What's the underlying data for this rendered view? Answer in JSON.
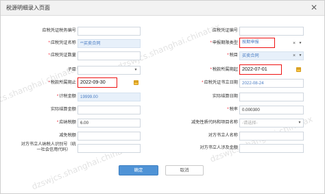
{
  "dialog": {
    "title": "税源明细录入页面",
    "close_glyph": "✕"
  },
  "form": {
    "left": [
      {
        "label": "应税凭证税务编号",
        "required": false,
        "value": ""
      },
      {
        "label": "应税凭证名称",
        "required": true,
        "value": "**买卖合同"
      },
      {
        "label": "应税凭证数量",
        "required": true,
        "value": ""
      },
      {
        "label": "子目",
        "required": false,
        "value": ""
      },
      {
        "label": "税款所属期止",
        "required": true,
        "value": "2022-09-30"
      },
      {
        "label": "计税金额",
        "required": true,
        "value": "19999.00"
      },
      {
        "label": "实际结算金额",
        "required": false,
        "value": ""
      },
      {
        "label": "应纳税额",
        "required": true,
        "value": "6.00"
      },
      {
        "label": "减免税额",
        "required": false,
        "value": ""
      },
      {
        "label": "对方书立人纳税人识别号（统一社会信用代码）",
        "label_line1": "对方书立人纳税人识别号（统",
        "label_line2": "一社会信用代码）",
        "required": false,
        "value": ""
      }
    ],
    "right": [
      {
        "label": "应税凭证编号",
        "required": false,
        "value": ""
      },
      {
        "label": "申报期限类型",
        "required": true,
        "value": "按期申报"
      },
      {
        "label": "税目",
        "required": true,
        "value": "买卖合同"
      },
      {
        "label": "税款所属期起",
        "required": true,
        "value": "2022-07-01"
      },
      {
        "label": "应税凭证书立日期",
        "required": true,
        "value": "2022-08-24"
      },
      {
        "label": "实际结算日期",
        "required": false,
        "value": ""
      },
      {
        "label": "税率",
        "required": true,
        "value": "0.000300"
      },
      {
        "label": "减免性质代码和项目名称",
        "required": false,
        "value": "",
        "placeholder": "-请选择-"
      },
      {
        "label": "对方书立人名称",
        "required": false,
        "value": ""
      },
      {
        "label": "对方书立人涉及金额",
        "required": false,
        "value": ""
      }
    ]
  },
  "icons": {
    "caret": "▼",
    "clear": "×"
  },
  "buttons": {
    "confirm": "确定",
    "cancel": "取消"
  },
  "watermark": "dzswjcs.shanghai.chinatax"
}
